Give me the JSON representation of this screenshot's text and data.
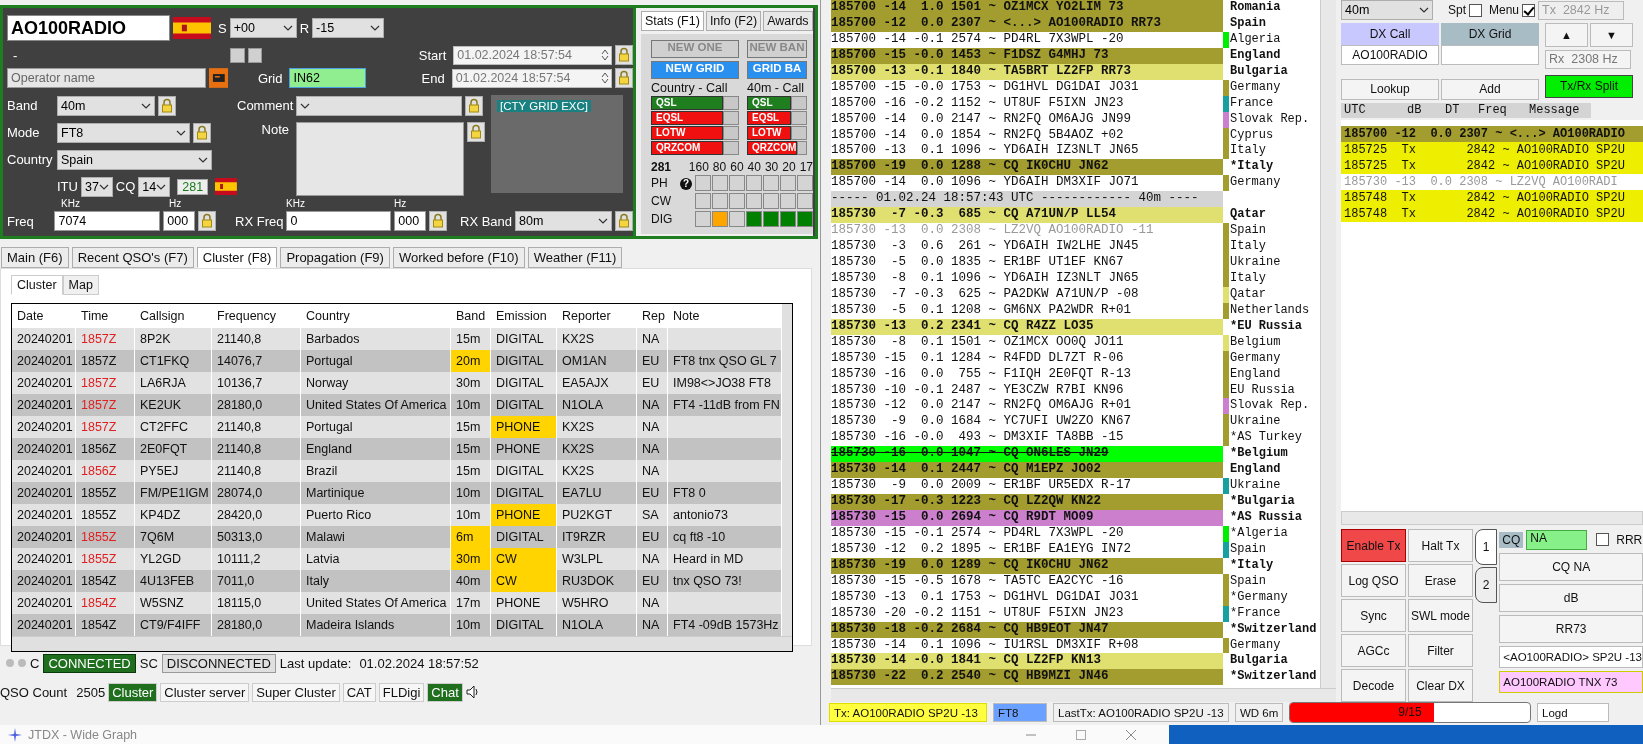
{
  "log_window": {
    "callsign": "AO100RADIO",
    "s_label": "S",
    "s_report": "+00",
    "r_label": "R",
    "r_report": "-15",
    "name_text": "-",
    "start_label": "Start",
    "start": "01.02.2024 18:57:54",
    "operator_placeholder": "Operator name",
    "grid_label": "Grid",
    "grid": "IN62",
    "end_label": "End",
    "end": "01.02.2024 18:57:54",
    "band_label": "Band",
    "band": "40m",
    "comment_label": "Comment",
    "mode_label": "Mode",
    "mode": "FT8",
    "note_label": "Note",
    "country_label": "Country",
    "country": "Spain",
    "itu_label": "ITU",
    "itu": "37",
    "cq_label": "CQ",
    "cq": "14",
    "dxcc_count": "281",
    "cty_tag": "[CTY GRID EXC]",
    "freq_khz_unit": "KHz",
    "freq_hz_unit": "Hz",
    "rx_khz_unit": "KHz",
    "rx_hz_unit": "Hz",
    "freq_label": "Freq",
    "freq_khz": "7074",
    "freq_hz": "000",
    "rx_freq_label": "RX Freq",
    "rx_freq_khz": "0",
    "rx_freq_hz": "000",
    "rx_band_label": "RX Band",
    "rx_band": "80m",
    "stats": {
      "tabs": [
        {
          "label": "Stats (F1)",
          "selected": true
        },
        {
          "label": "Info (F2)",
          "selected": false
        },
        {
          "label": "Awards",
          "selected": false
        }
      ],
      "buttons": [
        {
          "label": "NEW ONE",
          "active": false
        },
        {
          "label": "NEW BAN",
          "active": false
        },
        {
          "label": "NEW GRID",
          "active": true
        },
        {
          "label": "GRID BA",
          "active": true
        }
      ],
      "columns": [
        {
          "title": "Country - Call",
          "services": [
            {
              "label": "QSL",
              "confirmed": true
            },
            {
              "label": "EQSL",
              "confirmed": false
            },
            {
              "label": "LOTW",
              "confirmed": false
            },
            {
              "label": "QRZCOM",
              "confirmed": false
            }
          ]
        },
        {
          "title": "40m - Call",
          "services": [
            {
              "label": "QSL",
              "confirmed": true
            },
            {
              "label": "EQSL",
              "confirmed": false
            },
            {
              "label": "LOTW",
              "confirmed": false
            },
            {
              "label": "QRZCOM",
              "confirmed": false
            }
          ]
        }
      ],
      "count": "281",
      "bands": [
        "160",
        "80",
        "60",
        "40",
        "30",
        "20",
        "17"
      ],
      "modes": [
        {
          "label": "PH",
          "help": "?",
          "cells": [
            {
              "color": "#d4d4d4"
            },
            {
              "color": "#d4d4d4"
            },
            {
              "color": "#d4d4d4"
            },
            {
              "color": "#d4d4d4"
            },
            {
              "color": "#d4d4d4"
            },
            {
              "color": "#d4d4d4"
            },
            {
              "color": "#d4d4d4"
            }
          ]
        },
        {
          "label": "CW",
          "cells": [
            {
              "color": "#d4d4d4"
            },
            {
              "color": "#d4d4d4"
            },
            {
              "color": "#d4d4d4"
            },
            {
              "color": "#d4d4d4"
            },
            {
              "color": "#d4d4d4"
            },
            {
              "color": "#d4d4d4"
            },
            {
              "color": "#d4d4d4"
            }
          ]
        },
        {
          "label": "DIG",
          "cells": [
            {
              "color": "#d4d4d4"
            },
            {
              "color": "#ffa500"
            },
            {
              "color": "#d4d4d4"
            },
            {
              "color": "#008000"
            },
            {
              "color": "#008000"
            },
            {
              "color": "#008000"
            },
            {
              "color": "#008000"
            }
          ]
        }
      ]
    },
    "tabs": [
      {
        "label": "Main (F6)",
        "selected": false
      },
      {
        "label": "Recent QSO's (F7)",
        "selected": false
      },
      {
        "label": "Cluster (F8)",
        "selected": true
      },
      {
        "label": "Propagation (F9)",
        "selected": false
      },
      {
        "label": "Worked before (F10)",
        "selected": false
      },
      {
        "label": "Weather (F11)",
        "selected": false
      }
    ],
    "sub_tabs": [
      {
        "label": "Cluster",
        "selected": true
      },
      {
        "label": "Map",
        "selected": false
      }
    ],
    "cluster_columns": [
      "Date",
      "Time",
      "Callsign",
      "Frequency",
      "Country",
      "Band",
      "Emission",
      "Reporter",
      "Rep",
      "Note"
    ],
    "cluster_rows": [
      {
        "cells": [
          "20240201",
          "1857Z",
          "8P2K",
          "21140,8",
          "Barbados",
          "15m",
          "DIGITAL",
          "KX2S",
          "NA",
          ""
        ],
        "time_alert": true,
        "band_alert": false,
        "emission_alert": false
      },
      {
        "cells": [
          "20240201",
          "1857Z",
          "CT1FKQ",
          "14076,7",
          "Portugal",
          "20m",
          "DIGITAL",
          "OM1AN",
          "EU",
          "FT8 tnx QSO GL 7"
        ],
        "time_alert": false,
        "band_alert": true,
        "emission_alert": false
      },
      {
        "cells": [
          "20240201",
          "1857Z",
          "LA6RJA",
          "10136,7",
          "Norway",
          "30m",
          "DIGITAL",
          "EA5AJX",
          "EU",
          "IM98<>JO38 FT8"
        ],
        "time_alert": true,
        "band_alert": false,
        "emission_alert": false
      },
      {
        "cells": [
          "20240201",
          "1857Z",
          "KE2UK",
          "28180,0",
          "United States Of America",
          "10m",
          "DIGITAL",
          "N1OLA",
          "NA",
          "FT4 -11dB from FN"
        ],
        "time_alert": true,
        "band_alert": false,
        "emission_alert": false
      },
      {
        "cells": [
          "20240201",
          "1857Z",
          "CT2FFC",
          "21140,8",
          "Portugal",
          "15m",
          "PHONE",
          "KX2S",
          "NA",
          ""
        ],
        "time_alert": true,
        "band_alert": false,
        "emission_alert": true
      },
      {
        "cells": [
          "20240201",
          "1856Z",
          "2E0FQT",
          "21140,8",
          "England",
          "15m",
          "PHONE",
          "KX2S",
          "NA",
          ""
        ],
        "time_alert": false,
        "band_alert": false,
        "emission_alert": false
      },
      {
        "cells": [
          "20240201",
          "1856Z",
          "PY5EJ",
          "21140,8",
          "Brazil",
          "15m",
          "DIGITAL",
          "KX2S",
          "NA",
          ""
        ],
        "time_alert": true,
        "band_alert": false,
        "emission_alert": false
      },
      {
        "cells": [
          "20240201",
          "1855Z",
          "FM/PE1IGM",
          "28074,0",
          "Martinique",
          "10m",
          "DIGITAL",
          "EA7LU",
          "EU",
          "FT8 0"
        ],
        "time_alert": false,
        "band_alert": false,
        "emission_alert": false
      },
      {
        "cells": [
          "20240201",
          "1855Z",
          "KP4DZ",
          "28420,0",
          "Puerto Rico",
          "10m",
          "PHONE",
          "PU2KGT",
          "SA",
          "antonio73"
        ],
        "time_alert": false,
        "band_alert": false,
        "emission_alert": true
      },
      {
        "cells": [
          "20240201",
          "1855Z",
          "7Q6M",
          "50313,0",
          "Malawi",
          "6m",
          "DIGITAL",
          "IT9RZR",
          "EU",
          "cq ft8 -10"
        ],
        "time_alert": true,
        "band_alert": true,
        "emission_alert": false
      },
      {
        "cells": [
          "20240201",
          "1855Z",
          "YL2GD",
          "10111,2",
          "Latvia",
          "30m",
          "CW",
          "W3LPL",
          "NA",
          "Heard in MD"
        ],
        "time_alert": true,
        "band_alert": true,
        "emission_alert": true
      },
      {
        "cells": [
          "20240201",
          "1854Z",
          "4U13FEB",
          "7011,0",
          "Italy",
          "40m",
          "CW",
          "RU3DOK",
          "EU",
          "tnx QSO  73!"
        ],
        "time_alert": false,
        "band_alert": false,
        "emission_alert": true
      },
      {
        "cells": [
          "20240201",
          "1854Z",
          "W5SNZ",
          "18115,0",
          "United States Of America",
          "17m",
          "PHONE",
          "W5HRO",
          "NA",
          ""
        ],
        "time_alert": true,
        "band_alert": false,
        "emission_alert": false
      },
      {
        "cells": [
          "20240201",
          "1854Z",
          "CT9/F4IFF",
          "28180,0",
          "Madeira Islands",
          "10m",
          "DIGITAL",
          "N1OLA",
          "NA",
          "FT4 -09dB 1573Hz"
        ],
        "time_alert": false,
        "band_alert": false,
        "emission_alert": false
      }
    ],
    "connection": {
      "c_label": "C",
      "c_status": "CONNECTED",
      "c_connected": true,
      "sc_label": "SC",
      "sc_status": "DISCONNECTED",
      "sc_connected": false,
      "update_label": "Last update:",
      "update": "01.02.2024 18:57:52"
    },
    "status_bar": {
      "qso_label": "QSO Count",
      "qso_count": "2505",
      "items": [
        {
          "label": "Cluster",
          "active": true
        },
        {
          "label": "Cluster server",
          "active": false
        },
        {
          "label": "Super Cluster",
          "active": false
        },
        {
          "label": "CAT",
          "active": false
        },
        {
          "label": "FLDigi",
          "active": false
        },
        {
          "label": "Chat",
          "active": true
        }
      ]
    }
  },
  "main_window": {
    "decodes": [
      {
        "kind": "decode",
        "text": "185700 -14  1.0 1501 ~ OZ1MCX YO2LIM 73",
        "color": "#a39d2f",
        "country": "Romania"
      },
      {
        "kind": "decode",
        "text": "185700 -12  0.0 2307 ~ <...> AO100RADIO RR73",
        "color": "#a39d2f",
        "country": "Spain"
      },
      {
        "kind": "decode",
        "text": "185700 -14 -0.1 2574 ~ PD4RL 7X3WPL -20",
        "marker": {
          "color": "#00ee00"
        },
        "country": "Algeria"
      },
      {
        "kind": "decode",
        "text": "185700 -15 -0.0 1453 ~ F1DSZ G4MHJ 73",
        "color": "#a39d2f",
        "country": "England"
      },
      {
        "kind": "decode",
        "text": "185700 -13 -0.1 1840 ~ TA5BRT LZ2FP RR73",
        "color": "#e0e070",
        "country": "Bulgaria"
      },
      {
        "kind": "decode",
        "text": "185700 -15 -0.0 1753 ~ DG1HVL DG1DAI JO31",
        "marker": {
          "color": "#a39d2f"
        },
        "country": "Germany"
      },
      {
        "kind": "decode",
        "text": "185700 -16 -0.2 1152 ~ UT8UF F5IXN JN23",
        "marker": {
          "color": "#17a0a0"
        },
        "country": "France"
      },
      {
        "kind": "decode",
        "text": "185700 -14  0.0 2147 ~ RN2FQ OM6AJG JN99",
        "marker": {
          "color": "#cc7fcc"
        },
        "country": "Slovak Rep."
      },
      {
        "kind": "decode",
        "text": "185700 -14  0.0 1854 ~ RN2FQ 5B4AOZ +02",
        "marker": {
          "color": "#a39d2f"
        },
        "country": "Cyprus"
      },
      {
        "kind": "decode",
        "text": "185700 -13  0.1 1096 ~ YD6AIH IZ3NLT JN65",
        "marker": {
          "color": "#a39d2f"
        },
        "country": "Italy"
      },
      {
        "kind": "decode",
        "text": "185700 -19  0.0 1288 ~ CQ IK0CHU JN62",
        "color": "#a39d2f",
        "country": "*Italy"
      },
      {
        "kind": "decode",
        "text": "185700 -14  0.0 1096 ~ YD6AIH DM3XIF JO71",
        "marker": {
          "color": "#a39d2f"
        },
        "country": "Germany"
      },
      {
        "kind": "separator",
        "text": "----- 01.02.24 18:57:43 UTC ------------ 40m ----"
      },
      {
        "kind": "decode",
        "text": "185730  -7 -0.3  685 ~ CQ A71UN/P LL54",
        "color": "#e0e070",
        "country": "Qatar"
      },
      {
        "kind": "faded",
        "text": "185730 -13  0.0 2308 ~ LZ2VQ AO100RADIO -11",
        "marker": {
          "color": "#a39d2f"
        },
        "country": "Spain"
      },
      {
        "kind": "decode",
        "text": "185730  -3  0.6  261 ~ YD6AIH IW2LHE JN45",
        "marker": {
          "color": "#a39d2f"
        },
        "country": "Italy"
      },
      {
        "kind": "decode",
        "text": "185730  -5  0.0 1835 ~ ER1BF UT1EF KN67",
        "marker": {
          "color": "#a39d2f"
        },
        "country": "Ukraine"
      },
      {
        "kind": "decode",
        "text": "185730  -8  0.1 1096 ~ YD6AIH IZ3NLT JN65",
        "marker": {
          "color": "#a39d2f"
        },
        "country": "Italy"
      },
      {
        "kind": "decode",
        "text": "185730  -7 -0.3  625 ~ PA2DKW A71UN/P -08",
        "marker": {
          "color": "#e0e070"
        },
        "country": "Qatar"
      },
      {
        "kind": "decode",
        "text": "185730  -5  0.1 1208 ~ GM6NX PA2WDR R+01",
        "marker": {
          "color": "#a39d2f"
        },
        "country": "Netherlands"
      },
      {
        "kind": "decode",
        "text": "185730 -13  0.2 2341 ~ CQ R4ZZ LO35",
        "color": "#e0e070",
        "country": "*EU Russia"
      },
      {
        "kind": "decode",
        "text": "185730  -8  0.1 1501 ~ OZ1MCX OO0Q JO11",
        "marker": {
          "color": "#e0e070"
        },
        "country": "Belgium"
      },
      {
        "kind": "decode",
        "text": "185730 -15  0.1 1284 ~ R4FDD DL7ZT R-06",
        "marker": {
          "color": "#a39d2f"
        },
        "country": "Germany"
      },
      {
        "kind": "decode",
        "text": "185730 -16  0.0  755 ~ F1IQH 2E0FQT R-13",
        "marker": {
          "color": "#a39d2f"
        },
        "country": "England"
      },
      {
        "kind": "decode",
        "text": "185730 -10 -0.1 2487 ~ YE3CZW R7BI KN96",
        "marker": {
          "color": "#a39d2f"
        },
        "country": "EU Russia"
      },
      {
        "kind": "decode",
        "text": "185730 -12  0.0 2147 ~ RN2FQ OM6AJG R+01",
        "marker": {
          "color": "#cc7fcc"
        },
        "country": "Slovak Rep."
      },
      {
        "kind": "decode",
        "text": "185730  -9  0.0 1684 ~ YC7UFI UW2ZO KN67",
        "marker": {
          "color": "#a39d2f"
        },
        "country": "Ukraine"
      },
      {
        "kind": "decode",
        "text": "185730 -16 -0.0  493 ~ DM3XIF TA8BB -15",
        "marker": {
          "color": "#a39d2f"
        },
        "country": "*AS Turkey"
      },
      {
        "kind": "struck",
        "text": "185730 -16  0.0 1047 ~ CQ ON6LES JN29",
        "color": "#00ff00",
        "country": "*Belgium"
      },
      {
        "kind": "decode",
        "text": "185730 -14  0.1 2447 ~ CQ M1EPZ JO02",
        "color": "#a39d2f",
        "country": "England"
      },
      {
        "kind": "decode",
        "text": "185730  -9  0.0 2009 ~ ER1BF UR5EDX R-17",
        "marker": {
          "color": "#17a0a0"
        },
        "country": "Ukraine"
      },
      {
        "kind": "decode",
        "text": "185730 -17 -0.3 1223 ~ CQ LZ2QW KN22",
        "color": "#a39d2f",
        "country": "*Bulgaria"
      },
      {
        "kind": "decode",
        "text": "185730 -15  0.0 2694 ~ CQ R9DT MO09",
        "color": "#cc7fcc",
        "country": "*AS Russia"
      },
      {
        "kind": "decode",
        "text": "185730 -15 -0.1 2574 ~ PD4RL 7X3WPL -20",
        "marker": {
          "color": "#00ee00"
        },
        "country": "*Algeria"
      },
      {
        "kind": "decode",
        "text": "185730 -12  0.2 1895 ~ ER1BF EA1EYG IN72",
        "marker": {
          "color": "#17a0a0"
        },
        "country": "Spain"
      },
      {
        "kind": "decode",
        "text": "185730 -19  0.0 1289 ~ CQ IK0CHU JN62",
        "color": "#a39d2f",
        "country": "*Italy"
      },
      {
        "kind": "decode",
        "text": "185730 -15 -0.5 1678 ~ TA5TC EA2CYC -16",
        "marker": {
          "color": "#a39d2f"
        },
        "country": "Spain"
      },
      {
        "kind": "decode",
        "text": "185730 -13  0.1 1753 ~ DG1HVL DG1DAI JO31",
        "marker": {
          "color": "#a39d2f"
        },
        "country": "*Germany"
      },
      {
        "kind": "decode",
        "text": "185730 -20 -0.2 1151 ~ UT8UF F5IXN JN23",
        "marker": {
          "color": "#17a0a0"
        },
        "country": "*France"
      },
      {
        "kind": "decode",
        "text": "185730 -18 -0.2 2684 ~ CQ HB9EOT JN47",
        "color": "#a39d2f",
        "country": "*Switzerland"
      },
      {
        "kind": "decode",
        "text": "185730 -14  0.1 1096 ~ IU1RSL DM3XIF R+08",
        "marker": {
          "color": "#a39d2f"
        },
        "country": "Germany"
      },
      {
        "kind": "decode",
        "text": "185730 -14 -0.0 1841 ~ CQ LZ2FP KN13",
        "color": "#e0e070",
        "country": "Bulgaria"
      },
      {
        "kind": "decode",
        "text": "185730 -22  0.2 2540 ~ CQ HB9MZI JN46",
        "color": "#a39d2f",
        "country": "*Switzerland"
      }
    ],
    "tx_message": "Tx: AO100RADIO SP2U -13",
    "mode": "FT8",
    "last_tx": "LastTx: AO100RADIO SP2U -13",
    "wd": "WD 6m",
    "progress_text": "9/15",
    "progress": {
      "level": 0.6
    },
    "log_status": "Logd",
    "rx_panel": {
      "band": "40m",
      "spt_label": "Spt",
      "spt": false,
      "menu_label": "Menu",
      "menu": true,
      "tx_freq": "Tx  2842 Hz",
      "dx_call_label": "DX Call",
      "dx_grid_label": "DX Grid",
      "dx_call": "AO100RADIO",
      "up": "▲",
      "down": "▼",
      "rx_freq": "Rx  2308 Hz",
      "split": "Tx/Rx Split",
      "split_on": true,
      "lookup": "Lookup",
      "add": "Add",
      "columns": [
        "UTC",
        "dB",
        "DT",
        "Freq",
        "Message"
      ],
      "rows": [
        {
          "kind": "decode",
          "text": "185700 -12  0.0 2307 ~ <...> AO100RADIO",
          "color": "#a39d2f"
        },
        {
          "kind": "tx",
          "text": "185725  Tx       2842 ~ AO100RADIO SP2U",
          "color": "#eeee00"
        },
        {
          "kind": "tx",
          "text": "185725  Tx       2842 ~ AO100RADIO SP2U",
          "color": "#eeee00"
        },
        {
          "kind": "faded",
          "text": "185730 -13  0.0 2308 ~ LZ2VQ AO100RADI"
        },
        {
          "kind": "tx",
          "text": "185748  Tx       2842 ~ AO100RADIO SP2U",
          "color": "#eeee00"
        },
        {
          "kind": "tx",
          "text": "185748  Tx       2842 ~ AO100RADIO SP2U",
          "color": "#eeee00"
        }
      ],
      "buttons": [
        {
          "label": "Enable Tx",
          "on": true
        },
        {
          "label": "Halt Tx",
          "on": false
        },
        {
          "label": "Log QSO",
          "on": false
        },
        {
          "label": "Erase",
          "on": false
        },
        {
          "label": "Sync",
          "on": false
        },
        {
          "label": "SWL mode",
          "on": false
        },
        {
          "label": "AGCc",
          "on": false
        },
        {
          "label": "Filter",
          "on": false
        },
        {
          "label": "Decode",
          "on": false
        },
        {
          "label": "Clear DX",
          "on": false
        }
      ],
      "tabs": [
        {
          "label": "1",
          "selected": true
        },
        {
          "label": "2",
          "selected": false
        }
      ],
      "cq_label": "CQ",
      "cq_value": "NA",
      "rrr_label": "RRR",
      "rrr": false,
      "macros": [
        "CQ NA",
        "dB",
        "RR73"
      ],
      "tx5": "<AO100RADIO> SP2U -13",
      "tx6": "AO100RADIO TNX 73"
    }
  },
  "wide_graph": {
    "title": "JTDX - Wide Graph"
  }
}
